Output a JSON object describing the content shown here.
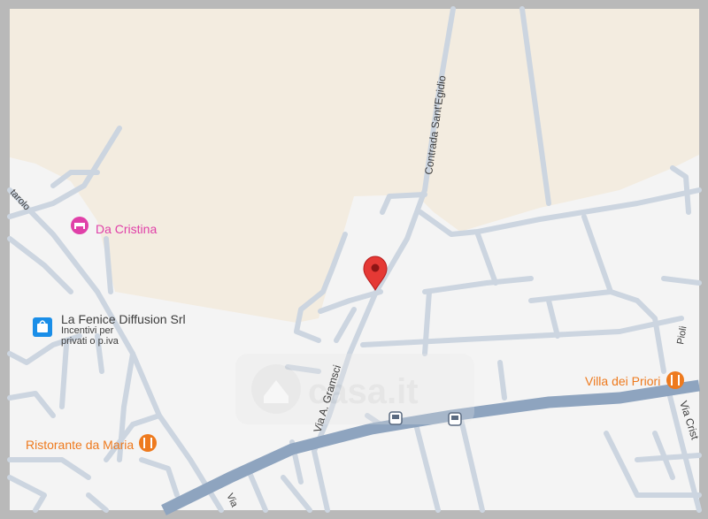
{
  "map": {
    "colors": {
      "frame": "#b9b9b9",
      "land": "#f4f4f4",
      "park": "#f3ece0",
      "street": "#ccd5e0",
      "main_road": "#8ea4bf",
      "hotel": "#e040a8",
      "restaurant": "#ee7a1e",
      "shop": "#1a8ee8",
      "pin": "#e53935",
      "text": "#3c3c3c"
    },
    "roads": {
      "contrada": "Contrada Sant'Egidio",
      "gramsci": "Via A. Gramsci",
      "via_crist": "Via Crist",
      "taroldo": "tarolo",
      "viale": "Via",
      "right_top": "Pioli"
    },
    "pois": {
      "da_cristina": {
        "name": "Da Cristina",
        "type": "hotel",
        "icon": "bed-icon"
      },
      "la_fenice": {
        "name": "La Fenice Diffusion Srl",
        "subline1": "Incentivi per",
        "subline2": "privati o p.iva",
        "type": "shop",
        "icon": "shopping-bag-icon"
      },
      "villa_dei_priori": {
        "name": "Villa dei Priori",
        "type": "restaurant",
        "icon": "fork-knife-icon"
      },
      "ristorante_da_maria": {
        "name": "Ristorante da Maria",
        "type": "restaurant",
        "icon": "fork-knife-icon"
      }
    },
    "bus_stops": [
      "bus-stop-icon",
      "bus-stop-icon"
    ],
    "watermark": "casa.it",
    "pin_icon": "location-pin-icon"
  }
}
